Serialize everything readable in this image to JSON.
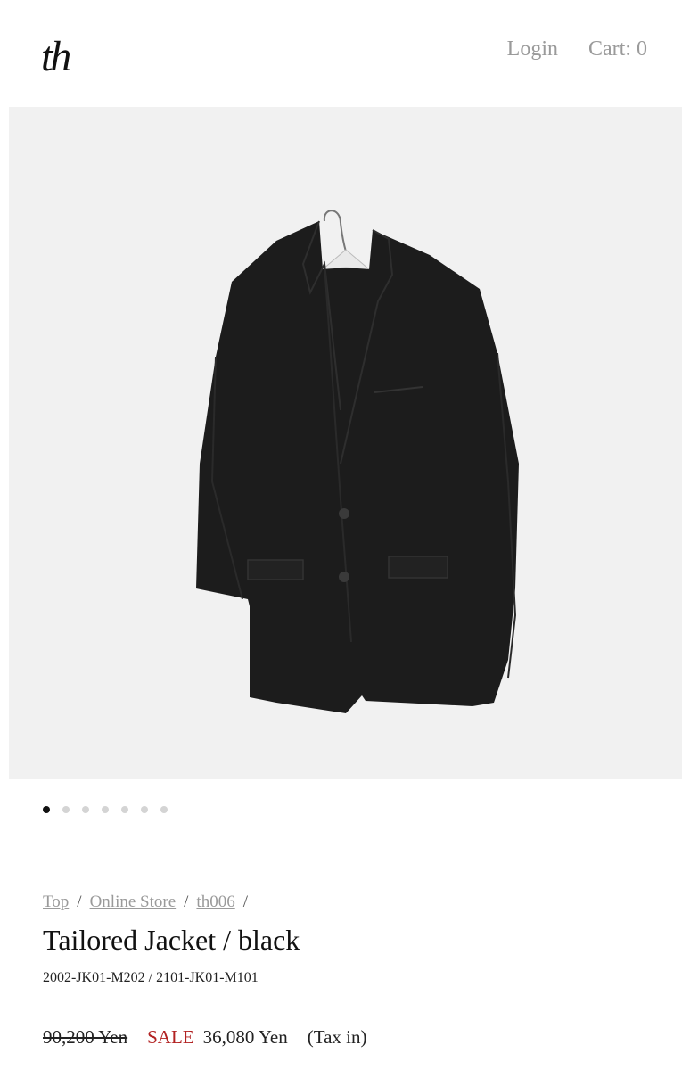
{
  "header": {
    "logo_text": "th",
    "login_label": "Login",
    "cart_label": "Cart: 0"
  },
  "hero": {
    "image_alt": "Tailored Jacket black on hanger",
    "background": "#f1f1f1",
    "slide_count": 7,
    "active_slide": 1
  },
  "breadcrumb": {
    "items": [
      "Top",
      "Online Store",
      "th006"
    ],
    "separator": "/"
  },
  "product": {
    "title": "Tailored Jacket / black",
    "sku": "2002-JK01-M202 / 2101-JK01-M101",
    "original_price": "90,200 Yen",
    "sale_label": "SALE",
    "sale_price": "36,080 Yen",
    "tax_note": "(Tax in)"
  },
  "colors": {
    "sale": "#b22222",
    "muted": "#9a9a9a"
  }
}
